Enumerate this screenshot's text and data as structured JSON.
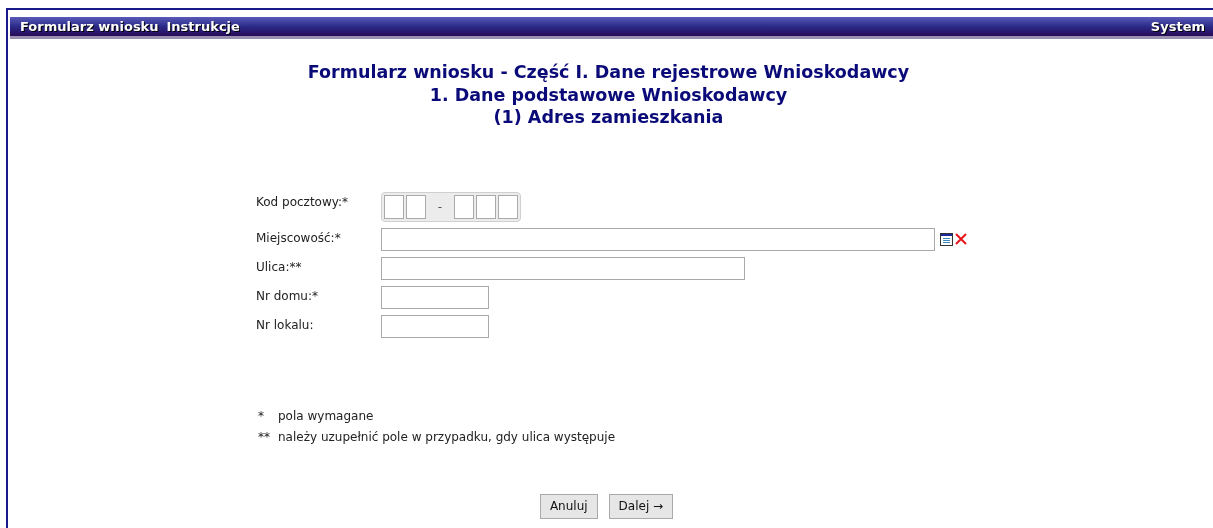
{
  "menu_bar": {
    "items": [
      "Formularz wniosku",
      "Instrukcje"
    ],
    "right_item": "System"
  },
  "heading": [
    "Formularz wniosku - Część I. Dane rejestrowe Wnioskodawcy",
    "1. Dane podstawowe Wnioskodawcy",
    "(1) Adres zamieszkania"
  ],
  "fields": [
    {
      "label": "Kod pocztowy:*",
      "kind": "postal",
      "separator": "-"
    },
    {
      "label": "Miejscowość:*",
      "kind": "lookup"
    },
    {
      "label": "Ulica:**",
      "kind": "text"
    },
    {
      "label": "Nr domu:*",
      "kind": "short"
    },
    {
      "label": "Nr lokalu:",
      "kind": "short"
    }
  ],
  "notes": [
    {
      "mark": "*",
      "text": "pola wymagane"
    },
    {
      "mark": "**",
      "text": "należy uzupełnić pole w przypadku, gdy ulica występuje"
    }
  ],
  "buttons": [
    {
      "label": "Anuluj",
      "kind": "plain"
    },
    {
      "label": "Dalej",
      "kind": "next",
      "arrow": "→"
    }
  ]
}
